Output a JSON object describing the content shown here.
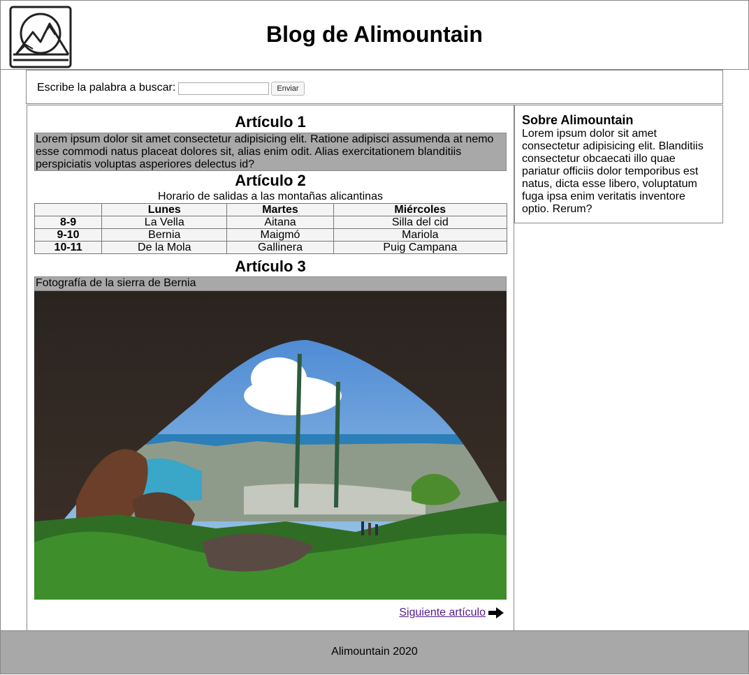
{
  "header": {
    "title": "Blog de Alimountain",
    "logo_icon": "mountain-logo-icon"
  },
  "search": {
    "label": "Escribe la palabra a buscar:",
    "value": "",
    "placeholder": "",
    "button_label": "Enviar"
  },
  "articles": [
    {
      "title": "Artículo 1",
      "text": "Lorem ipsum dolor sit amet consectetur adipisicing elit. Ratione adipisci assumenda at nemo esse commodi natus placeat dolores sit, alias enim odit. Alias exercitationem blanditiis perspiciatis voluptas asperiores delectus id?"
    },
    {
      "title": "Artículo 2",
      "caption": "Horario de salidas a las montañas alicantinas",
      "table": {
        "headers": [
          "",
          "Lunes",
          "Martes",
          "Miércoles"
        ],
        "rows": [
          [
            "8-9",
            "La Vella",
            "Aitana",
            "Silla del cid"
          ],
          [
            "9-10",
            "Bernia",
            "Maigmó",
            "Mariola"
          ],
          [
            "10-11",
            "De la Mola",
            "Gallinera",
            "Puig Campana"
          ]
        ]
      }
    },
    {
      "title": "Artículo 3",
      "caption": "Fotografía de la sierra de Bernia"
    }
  ],
  "next_link": {
    "label": "Siguiente artículo",
    "icon": "arrow-right-icon"
  },
  "aside": {
    "title": "Sobre Alimountain",
    "text": "Lorem ipsum dolor sit amet consectetur adipisicing elit. Blanditiis consectetur obcaecati illo quae pariatur officiis dolor temporibus est natus, dicta esse libero, voluptatum fuga ipsa enim veritatis inventore optio. Rerum?"
  },
  "footer": {
    "text": "Alimountain 2020"
  },
  "colors": {
    "gray_band": "#a8a8a8",
    "link": "#551a8b"
  }
}
